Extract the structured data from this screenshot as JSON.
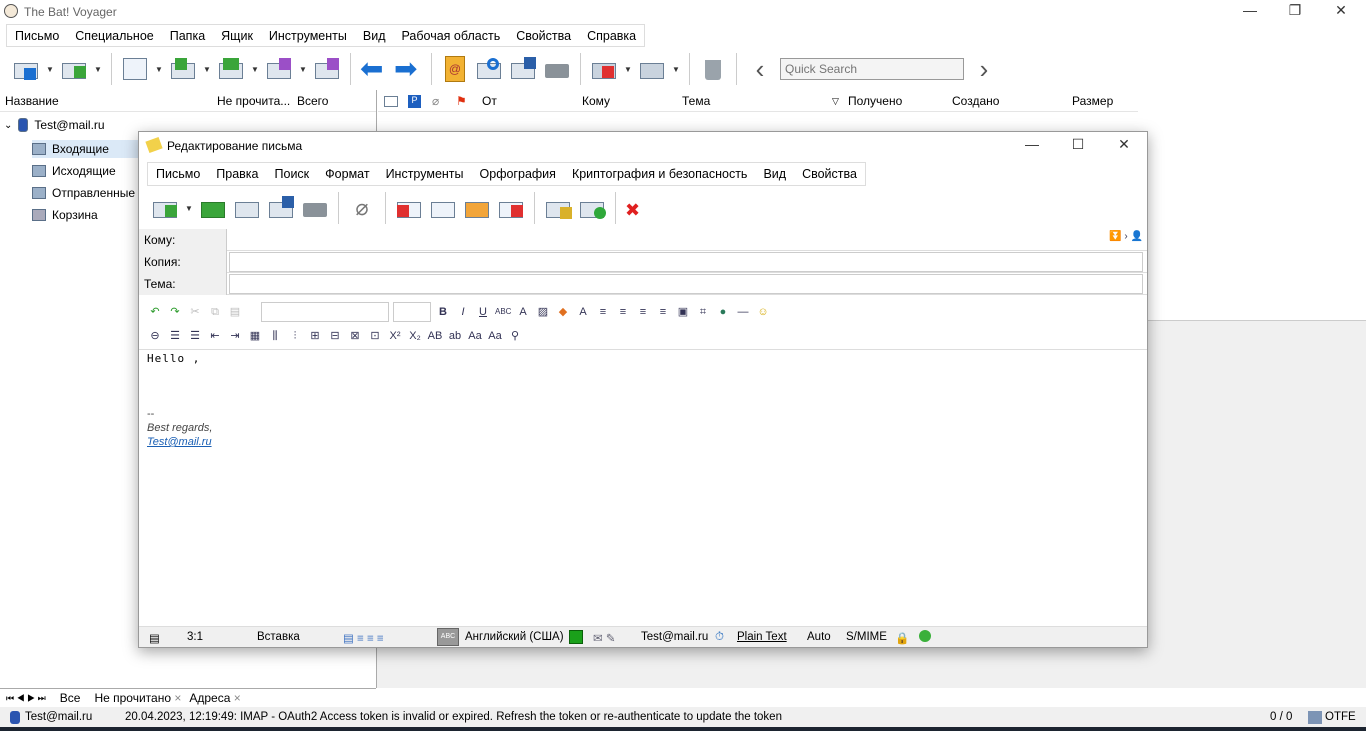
{
  "app": {
    "title": "The Bat! Voyager"
  },
  "menu": [
    "Письмо",
    "Специальное",
    "Папка",
    "Ящик",
    "Инструменты",
    "Вид",
    "Рабочая область",
    "Свойства",
    "Справка"
  ],
  "search": {
    "placeholder": "Quick Search"
  },
  "folder_columns": [
    "Название",
    "Не прочита...",
    "Всего"
  ],
  "message_columns": [
    "От",
    "Кому",
    "Тема",
    "Получено",
    "Создано",
    "Размер"
  ],
  "tree": {
    "account": "Test@mail.ru",
    "folders": [
      "Входящие",
      "Исходящие",
      "Отправленные",
      "Корзина"
    ],
    "selected": "Входящие"
  },
  "tabs": [
    "Все",
    "Не прочитано",
    "Адреса"
  ],
  "status": {
    "account": "Test@mail.ru",
    "message": "20.04.2023, 12:19:49: IMAP  - OAuth2 Access token is invalid or expired. Refresh the token or re-authenticate to update the token",
    "count": "0 / 0",
    "otfe": "OTFE"
  },
  "compose": {
    "title": "Редактирование письма",
    "menu": [
      "Письмо",
      "Правка",
      "Поиск",
      "Формат",
      "Инструменты",
      "Орфография",
      "Криптография и безопасность",
      "Вид",
      "Свойства"
    ],
    "fields": [
      {
        "label": "Кому:",
        "value": ""
      },
      {
        "label": "Копия:",
        "value": ""
      },
      {
        "label": "Тема:",
        "value": ""
      }
    ],
    "body": {
      "greeting": "Hello ,",
      "sig_sep": "--",
      "sig_line": "Best regards,",
      "sig_link": "Test@mail.ru"
    },
    "statusbar": {
      "pos": "3:1",
      "mode": "Вставка",
      "lang": "Английский (США)",
      "from": "Test@mail.ru",
      "format": "Plain Text",
      "charset": "Auto",
      "security": "S/MIME"
    }
  }
}
